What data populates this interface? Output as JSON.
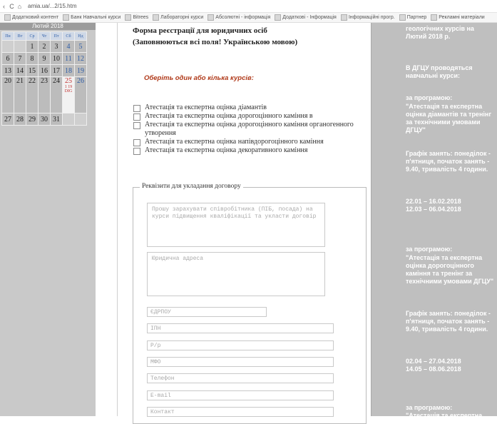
{
  "browser": {
    "url": "amia.ua/...2/15.htm",
    "nav": [
      "‹",
      "C",
      "⌂"
    ],
    "bookmarks": [
      "Додатковий контент",
      "Банк Навчальні курси",
      "Bitrees",
      "Лабораторні курси",
      "Абсолютні - інформація",
      "Додаткові - Інформація",
      "Інформаційні прогр.",
      "Партнер",
      "Рекламні матеріали"
    ]
  },
  "calendar": {
    "title": "Лютий 2018",
    "weekdays": [
      "Пн",
      "Вт",
      "Ср",
      "Чт",
      "Пт",
      "Сб",
      "Нд"
    ],
    "rows": [
      [
        "",
        "",
        "1",
        "2",
        "3",
        "4",
        "5"
      ],
      [
        "6",
        "7",
        "8",
        "9",
        "10",
        "11",
        "12"
      ],
      [
        "13",
        "14",
        "15",
        "16",
        "17",
        "18",
        "19"
      ],
      [
        "20",
        "21",
        "22",
        "23",
        "24",
        "25",
        "26"
      ],
      [
        "27",
        "28",
        "29",
        "30",
        "31",
        "",
        ""
      ]
    ],
    "today_event": "1 19 DIG"
  },
  "form": {
    "title_line1": "Форма реєстрації для юридичних осіб",
    "title_line2": "(Заповнюються всі поля! Українською мовою)",
    "note": "Оберіть один або кілька курсів:",
    "courses": [
      "Атестація та експертна оцінка діамантів",
      "Атестація та експертна оцінка дорогоцінного каміння в",
      "Атестація та експертна оцінка дорогоцінного каміння органогенного утворення",
      "Атестація та експертна оцінка напівдорогоцінного каміння",
      "Атестація та експертна оцінка декоративного каміння"
    ],
    "legend": "Реквізити для укладання договору",
    "placeholders": {
      "org_name": "Прошу зарахувати співробітника (ПІБ, посада) на курси підвищення кваліфікації та укласти договір",
      "legal_address": "Юридична адреса",
      "edrpou": "ЄДРПОУ",
      "ipn": "ІПН",
      "account": "Р/р",
      "bank": "МФО",
      "phone": "Телефон",
      "email": "E-mail",
      "contact": "Контакт"
    }
  },
  "sidebar": {
    "heading": "геологічних курсів на Лютий 2018 р.",
    "intro": "В ДГЦУ проводяться навчальні курси:",
    "programs": [
      {
        "label": "за програмою:",
        "name": "\"Атестація та експертна оцінка діамантів та тренінг за технічними умовами ДГЦУ\"",
        "schedule": "Графік занять: понеділок - п'ятниця, початок занять - 9.40, тривалість 4 години.",
        "dates": [
          "22.01 – 16.02.2018",
          "12.03 – 06.04.2018"
        ]
      },
      {
        "label": "за програмою:",
        "name": "\"Атестація та експертна оцінка дорогоцінного каміння та тренінг за технічними умовами ДГЦУ\"",
        "schedule": "Графік занять: понеділок - п'ятниця, початок занять - 9.40, тривалість 4 години.",
        "dates": [
          "02.04 – 27.04.2018",
          "14.05 – 08.06.2018"
        ]
      },
      {
        "label": "за програмою:",
        "name": "\"Атестація та експертна"
      }
    ]
  }
}
